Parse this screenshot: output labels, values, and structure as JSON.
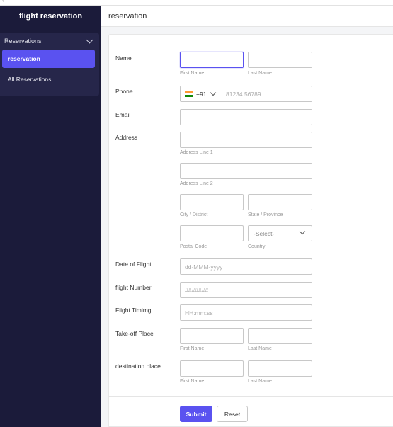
{
  "sidebar": {
    "app_title": "flight reservation",
    "group_label": "Reservations",
    "items": [
      {
        "label": "reservation",
        "active": true
      },
      {
        "label": "All Reservations",
        "active": false
      }
    ]
  },
  "header": {
    "title": "reservation"
  },
  "form": {
    "name": {
      "label": "Name",
      "first_sub": "First Name",
      "last_sub": "Last Name"
    },
    "phone": {
      "label": "Phone",
      "country_code": "+91",
      "placeholder": "81234 56789"
    },
    "email": {
      "label": "Email"
    },
    "address": {
      "label": "Address",
      "line1_sub": "Address Line 1",
      "line2_sub": "Address Line 2",
      "city_sub": "City / District",
      "state_sub": "State / Province",
      "postal_sub": "Postal Code",
      "country_sub": "Country",
      "country_value": "-Select-"
    },
    "date": {
      "label": "Date of Flight",
      "placeholder": "dd-MMM-yyyy"
    },
    "flight_number": {
      "label": "flight Number",
      "placeholder": "#######"
    },
    "flight_time": {
      "label": "Flight Timimg",
      "placeholder": "HH:mm:ss"
    },
    "takeoff": {
      "label": "Take-off Place",
      "first_sub": "First Name",
      "last_sub": "Last Name"
    },
    "destination": {
      "label": "destination place",
      "first_sub": "First Name",
      "last_sub": "Last Name"
    }
  },
  "actions": {
    "submit": "Submit",
    "reset": "Reset"
  },
  "colors": {
    "sidebar_bg": "#1b1b3a",
    "accent": "#5a52f0"
  }
}
